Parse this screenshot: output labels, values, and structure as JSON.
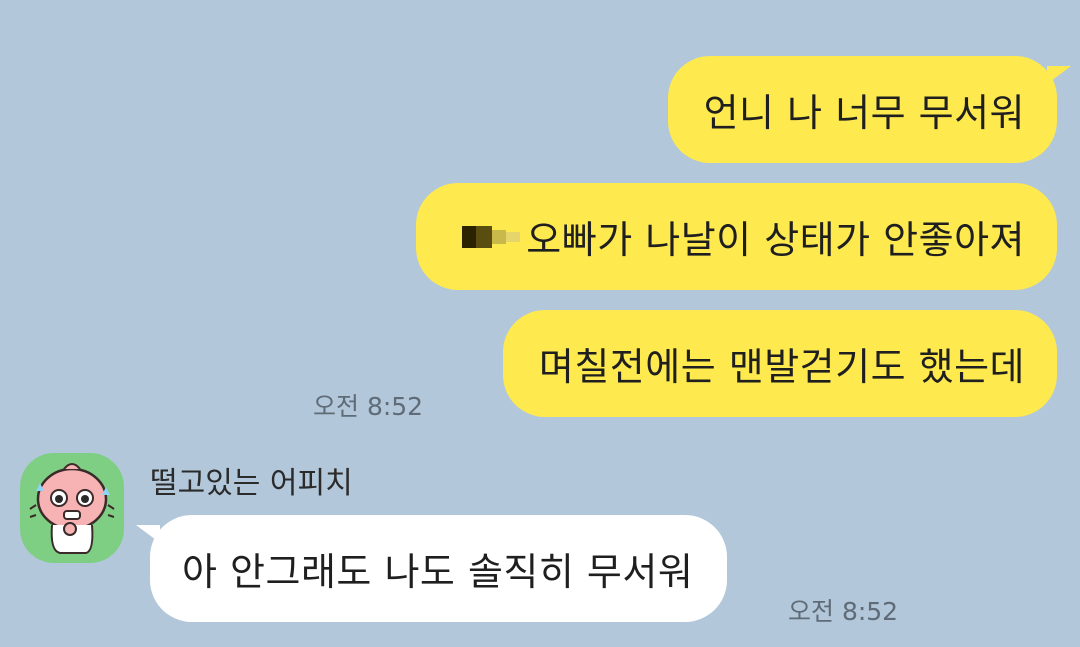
{
  "colors": {
    "background": "#b2c7da",
    "outgoing_bubble": "#fee94e",
    "incoming_bubble": "#ffffff",
    "avatar_background": "#7ecf83",
    "timestamp": "#5f6b77"
  },
  "messages_out": [
    {
      "text": "언니 나 너무 무서워"
    },
    {
      "text": "오빠가 나날이 상태가 안좋아져",
      "prefix": "pixelated-name"
    },
    {
      "text": "며칠전에는 맨발걷기도 했는데"
    }
  ],
  "out_time": "오전 8:52",
  "incoming": {
    "sender": "떨고있는 어피치",
    "avatar_icon": "apeach-character-icon",
    "message": "아 안그래도 나도 솔직히 무서워",
    "time": "오전 8:52"
  }
}
